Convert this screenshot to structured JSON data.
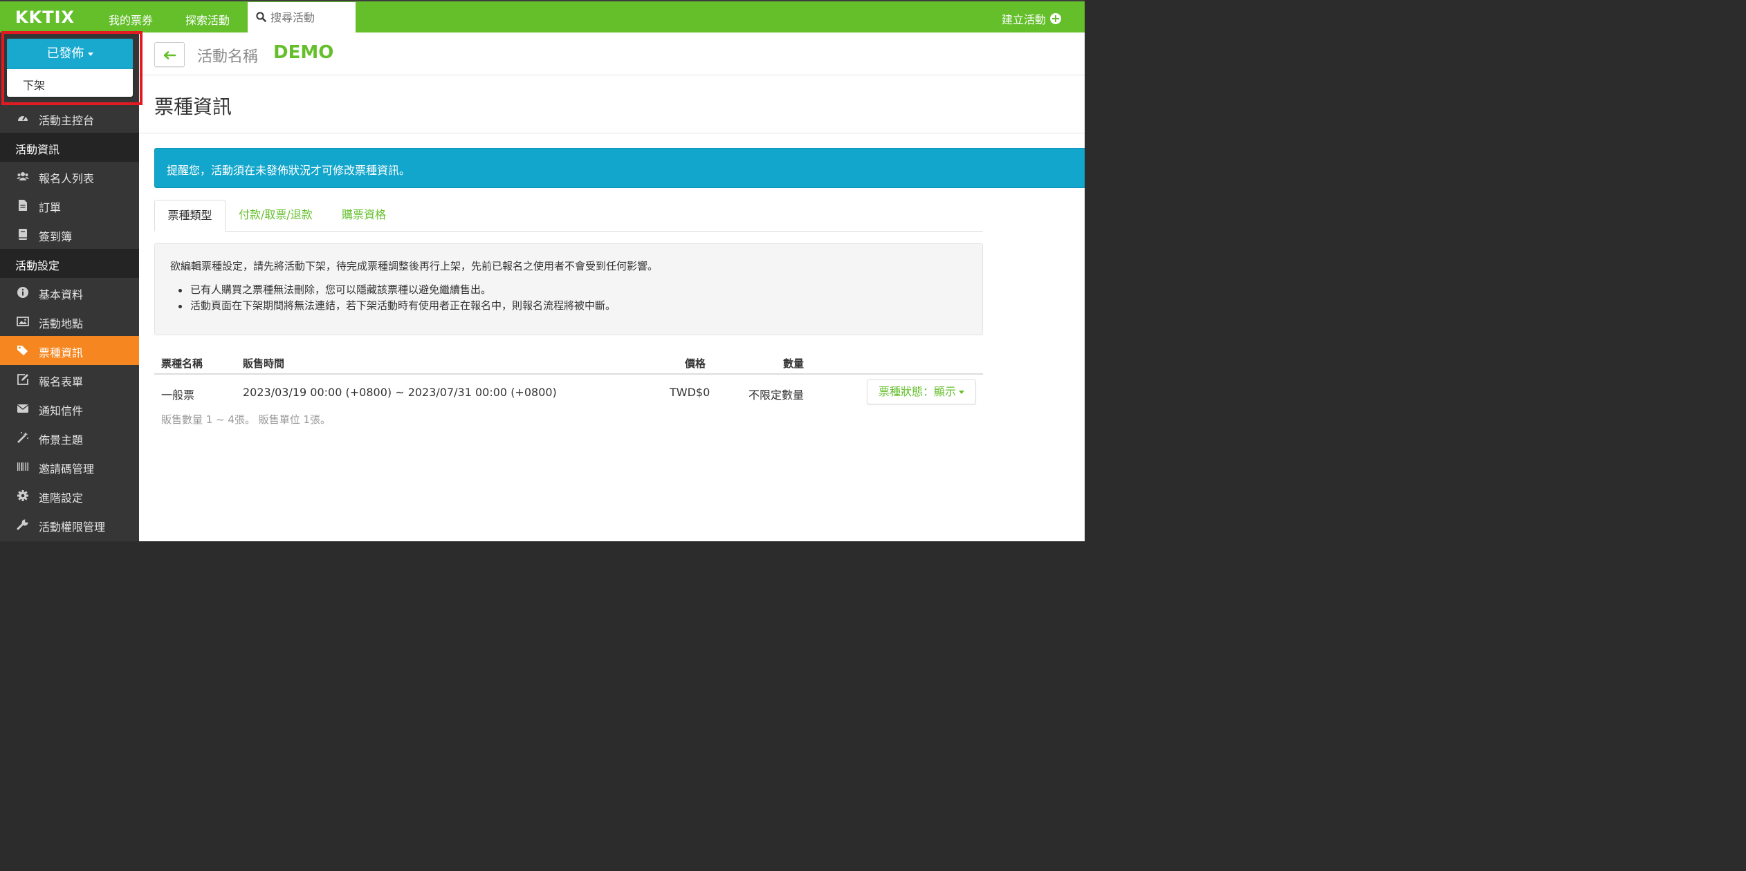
{
  "header": {
    "logo": "KKTIX",
    "nav": [
      "我的票券",
      "探索活動"
    ],
    "search_placeholder": "搜尋活動",
    "create_label": "建立活動"
  },
  "status": {
    "current": "已發佈",
    "dropdown_item": "下架"
  },
  "sidebar": {
    "dashboard": "活動主控台",
    "group1": "活動資訊",
    "attendees": "報名人列表",
    "orders": "訂單",
    "checkin": "簽到簿",
    "group2": "活動設定",
    "basic": "基本資料",
    "location": "活動地點",
    "tickets": "票種資訊",
    "form": "報名表單",
    "notify": "通知信件",
    "theme": "佈景主題",
    "invite": "邀請碼管理",
    "advanced": "進階設定",
    "permissions": "活動權限管理"
  },
  "title_bar": {
    "event_label": "活動名稱",
    "event_name": "DEMO"
  },
  "section_title": "票種資訊",
  "alert": "提醒您，活動須在未發佈狀況才可修改票種資訊。",
  "tabs": [
    "票種類型",
    "付款/取票/退款",
    "購票資格"
  ],
  "info": {
    "intro": "欲編輯票種設定，請先將活動下架，待完成票種調整後再行上架，先前已報名之使用者不會受到任何影響。",
    "bullets": [
      "已有人購買之票種無法刪除，您可以隱藏該票種以避免繼續售出。",
      "活動頁面在下架期間將無法連結，若下架活動時有使用者正在報名中，則報名流程將被中斷。"
    ]
  },
  "table": {
    "headers": [
      "票種名稱",
      "販售時間",
      "價格",
      "數量"
    ],
    "rows": [
      {
        "name": "一般票",
        "period": "2023/03/19 00:00 (+0800) ~ 2023/07/31 00:00 (+0800)",
        "price": "TWD$0",
        "quantity": "不限定數量",
        "state_button": "票種狀態：顯示",
        "note": "販售數量 1 ~ 4張。 販售單位 1張。"
      }
    ]
  },
  "colors": {
    "brand_green": "#64bf2b",
    "status_blue": "#19a9cf",
    "active_orange": "#f6861f",
    "highlight_red": "#e21b23"
  }
}
